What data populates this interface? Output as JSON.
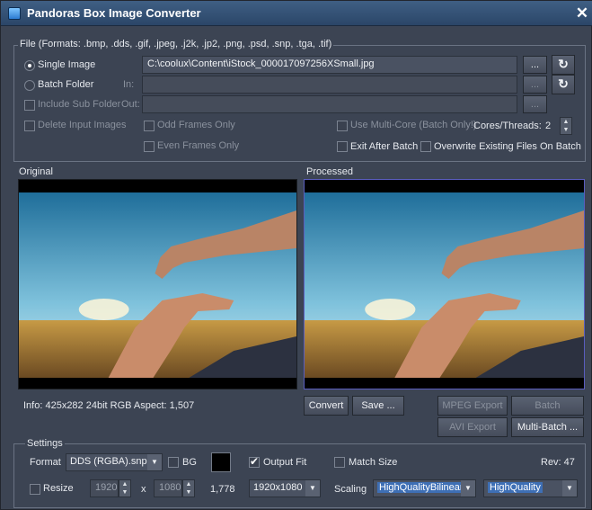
{
  "window": {
    "title": "Pandoras Box Image Converter"
  },
  "file_group": {
    "label": "File (Formats: .bmp, .dds, .gif, .jpeg, .j2k, .jp2, .png, .psd, .snp, .tga, .tif)",
    "single_image_label": "Single Image",
    "batch_folder_label": "Batch Folder",
    "include_sub_folder_label": "Include Sub Folder",
    "delete_input_images_label": "Delete Input Images",
    "odd_frames_only_label": "Odd Frames Only",
    "even_frames_only_label": "Even Frames Only",
    "use_multicore_label": "Use Multi-Core (Batch Only!)",
    "cores_threads_label": "Cores/Threads:",
    "cores_threads_value": "2",
    "exit_after_batch_label": "Exit After Batch",
    "overwrite_label": "Overwrite Existing Files On Batch",
    "in_label": "In:",
    "out_label": "Out:",
    "single_path": "C:\\coolux\\Content\\iStock_000017097256XSmall.jpg",
    "browse_label": "...",
    "refresh_glyph": "↻"
  },
  "preview": {
    "original_label": "Original",
    "processed_label": "Processed",
    "info_text": "Info:  425x282 24bit RGB Aspect: 1,507"
  },
  "actions": {
    "convert_label": "Convert",
    "save_label": "Save ...",
    "mpeg_export_label": "MPEG Export",
    "batch_label": "Batch",
    "avi_export_label": "AVI Export",
    "multi_batch_label": "Multi-Batch ..."
  },
  "settings": {
    "label": "Settings",
    "format_label": "Format",
    "format_value": "DDS (RGBA).snp",
    "bg_label": "BG",
    "bg_color": "#000000",
    "output_fit_label": "Output Fit",
    "match_size_label": "Match Size",
    "rev_text": "Rev: 47",
    "resize_label": "Resize",
    "width_value": "1920",
    "times_label": "x",
    "height_value": "1080",
    "aspect_value": "1,778",
    "resolution_value": "1920x1080",
    "scaling_label": "Scaling",
    "scaling_value": "HighQualityBilinear",
    "quality_value": "HighQuality"
  },
  "icons": {
    "close": "✕",
    "dropdown": "▼",
    "spin_up": "▲",
    "spin_down": "▼"
  }
}
